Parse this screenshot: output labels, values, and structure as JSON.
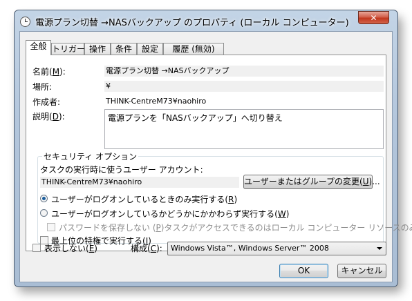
{
  "window": {
    "title": "電源プラン切替 →NASバックアップ のプロパティ (ローカル コンピューター)",
    "close_label": "✕"
  },
  "tabs": [
    {
      "label": "全般"
    },
    {
      "label": "トリガー"
    },
    {
      "label": "操作"
    },
    {
      "label": "条件"
    },
    {
      "label": "設定"
    },
    {
      "label": "履歴 (無効)"
    }
  ],
  "general": {
    "name_label_pre": "名前(",
    "name_label_key": "M",
    "name_label_post": "):",
    "name_value": "電源プラン切替 →NASバックアップ",
    "location_label": "場所:",
    "location_value": "¥",
    "author_label": "作成者:",
    "author_value": "THINK-CentreM73¥naohiro",
    "description_label_pre": "説明(",
    "description_label_key": "D",
    "description_label_post": "):",
    "description_value": "電源プランを「NASバックアップ」へ切り替え"
  },
  "security": {
    "group_title": "セキュリティ オプション",
    "account_label": "タスクの実行時に使うユーザー アカウント:",
    "account_value": "THINK-CentreM73¥naohiro",
    "change_button_pre": "ユーザーまたはグループの変更(",
    "change_button_key": "U",
    "change_button_post": ")...",
    "radio_logged_on_pre": "ユーザーがログオンしているときのみ実行する(",
    "radio_logged_on_key": "R",
    "radio_logged_on_post": ")",
    "radio_whether_pre": "ユーザーがログオンしているかどうかにかかわらず実行する(",
    "radio_whether_key": "W",
    "radio_whether_post": ")",
    "no_store_password_pre": "パスワードを保存しない (",
    "no_store_password_key": "P",
    "no_store_password_post": ")タスクがアクセスできるのはローカル コンピューター リソースのみ",
    "highest_privileges_pre": "最上位の特権で実行する(",
    "highest_privileges_key": "I",
    "highest_privileges_post": ")"
  },
  "bottom": {
    "hidden_pre": "表示しない(",
    "hidden_key": "E",
    "hidden_post": ")",
    "configure_pre": "構成(",
    "configure_key": "C",
    "configure_post": "):",
    "configure_value": "Windows Vista™, Windows Server™ 2008",
    "ok_label": "OK",
    "cancel_label": "キャンセル"
  },
  "state": {
    "radio_logged_on_selected": true,
    "radio_whether_selected": false,
    "no_store_password_checked": false,
    "no_store_password_enabled": false,
    "highest_privileges_checked": false,
    "hidden_checked": false
  }
}
